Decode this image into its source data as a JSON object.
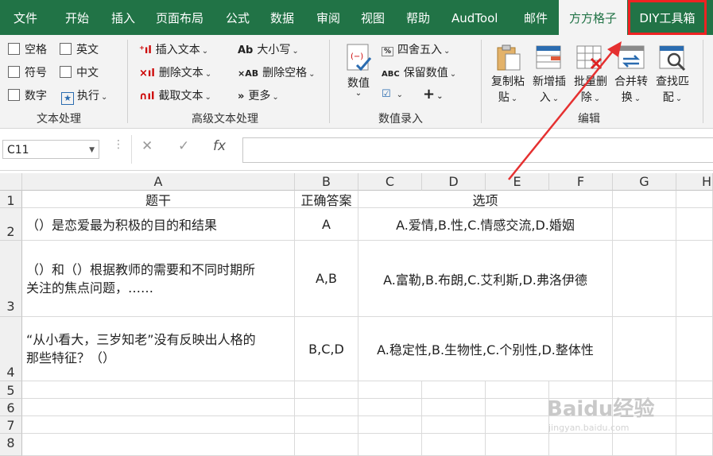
{
  "tabs": [
    "文件",
    "开始",
    "插入",
    "页面布局",
    "公式",
    "数据",
    "审阅",
    "视图",
    "帮助",
    "AudTool",
    "邮件",
    "方方格子",
    "DIY工具箱"
  ],
  "ribbon": {
    "text_group": {
      "english": "英文",
      "symbol": "符号",
      "chinese": "中文",
      "number": "数字",
      "execute": "执行",
      "space": "空格",
      "label": "文本处理"
    },
    "adv_group": {
      "insert": "插入文本",
      "delete": "删除文本",
      "cut": "截取文本",
      "case": "大小写",
      "del_space": "删除空格",
      "more": "更多",
      "label": "高级文本处理"
    },
    "num_group": {
      "num_big": "数值",
      "round": "四舍五入",
      "keep": "保留数值",
      "label": "数值录入"
    },
    "edit_group": {
      "copy_paste": [
        "复制粘",
        "贴"
      ],
      "add_insert": [
        "新增插",
        "入"
      ],
      "batch_delete": [
        "批量删",
        "除"
      ],
      "merge_convert": [
        "合并转",
        "换"
      ],
      "find_match": [
        "查找匹",
        "配"
      ],
      "label": "编辑"
    }
  },
  "formula_bar": {
    "cell_ref": "C11",
    "fx": "fx",
    "value": ""
  },
  "columns": [
    "A",
    "B",
    "C",
    "D",
    "E",
    "F",
    "G",
    "H"
  ],
  "rows": [
    {
      "num": "1",
      "a": "题干",
      "b": "正确答案",
      "c": "选项"
    },
    {
      "num": "2",
      "a": "（）是恋爱最为积极的目的和结果",
      "b": "A",
      "c": "A.爱情,B.性,C.情感交流,D.婚姻"
    },
    {
      "num": "3",
      "a": "（）和（）根据教师的需要和不同时期所关注的焦点问题，……",
      "b": "A,B",
      "c": "A.富勒,B.布朗,C.艾利斯,D.弗洛伊德"
    },
    {
      "num": "4",
      "a": "“从小看大，三岁知老”没有反映出人格的那些特征？（）",
      "b": "B,C,D",
      "c": "A.稳定性,B.生物性,C.个别性,D.整体性"
    },
    {
      "num": "5"
    },
    {
      "num": "6"
    },
    {
      "num": "7"
    },
    {
      "num": "8"
    }
  ],
  "watermark": {
    "main": "Baidu经验",
    "sub": "jingyan.baidu.com"
  }
}
